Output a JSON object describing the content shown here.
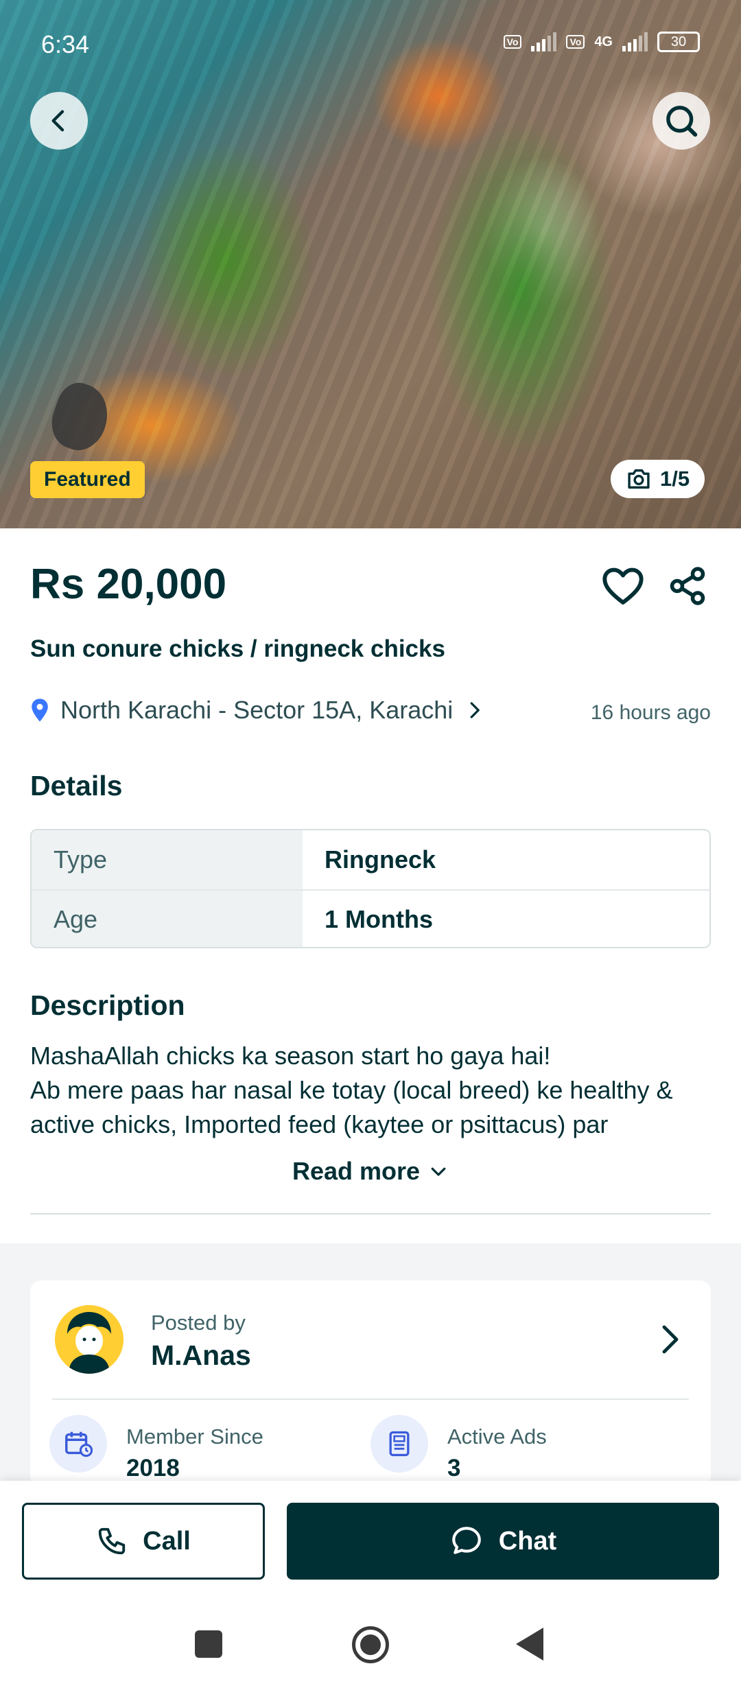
{
  "status_bar": {
    "time": "6:34",
    "network": "4G",
    "battery": "30"
  },
  "hero": {
    "badge": "Featured",
    "image_counter": "1/5"
  },
  "listing": {
    "price": "Rs 20,000",
    "title": "Sun conure chicks / ringneck chicks",
    "location": "North Karachi - Sector 15A, Karachi",
    "posted_time": "16 hours ago"
  },
  "details": {
    "heading": "Details",
    "rows": [
      {
        "key": "Type",
        "value": "Ringneck"
      },
      {
        "key": "Age",
        "value": "1 Months"
      }
    ]
  },
  "description": {
    "heading": "Description",
    "lines": [
      "MashaAllah chicks ka season start ho gaya hai!",
      "Ab mere paas har nasal ke totay (local breed) ke healthy &",
      "active chicks, Imported feed  (kaytee or psittacus) par"
    ],
    "read_more": "Read more"
  },
  "seller": {
    "posted_by_label": "Posted by",
    "name": "M.Anas",
    "member_since_label": "Member Since",
    "member_since_value": "2018",
    "active_ads_label": "Active Ads",
    "active_ads_value": "3"
  },
  "actions": {
    "call": "Call",
    "chat": "Chat"
  },
  "colors": {
    "primary": "#002f34",
    "featured": "#ffce32",
    "location_pin": "#3a77ff"
  }
}
